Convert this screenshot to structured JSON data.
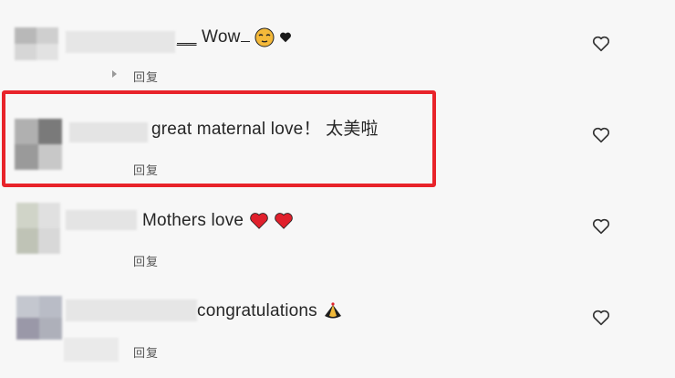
{
  "comments": [
    {
      "text": "Wow",
      "text_prefix": "__",
      "reply_label": "回复"
    },
    {
      "text": "great maternal love！ 太美啦",
      "reply_label": "回复"
    },
    {
      "text": "Mothers love",
      "reply_label": "回复"
    },
    {
      "text": "congratulations",
      "reply_label": "回复"
    }
  ],
  "colors": {
    "highlight_border": "#e8232a",
    "heart_red": "#e0202c",
    "background": "#f7f7f7"
  },
  "icons": {
    "like": "heart-outline-icon",
    "reply_arrow": "chevron-right-icon",
    "emoji_smile": "relieved-face-icon",
    "emoji_heart_black": "black-heart-icon",
    "emoji_red_heart": "red-heart-icon",
    "emoji_party": "party-popper-icon"
  }
}
